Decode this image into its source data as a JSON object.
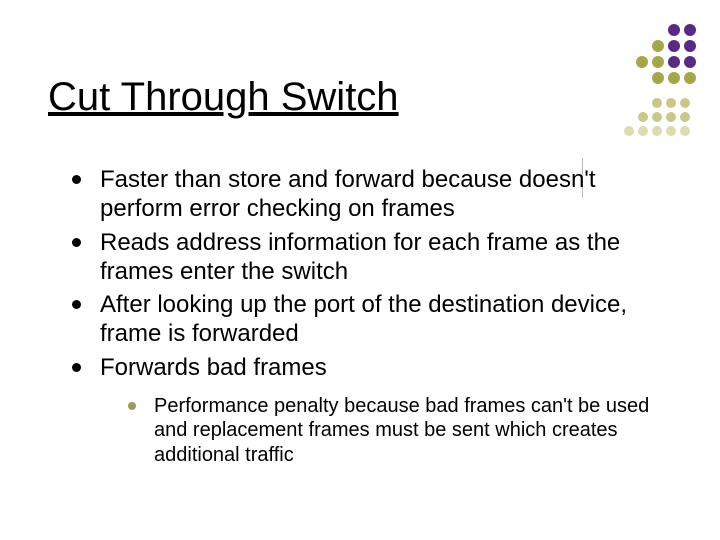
{
  "title": "Cut Through Switch",
  "bullets": {
    "b1": "Faster than store and forward because doesn't perform error checking on frames",
    "b2": "Reads address information for each frame as the frames enter the switch",
    "b3": "After looking up the port of the destination device, frame is forwarded",
    "b4": "Forwards bad frames",
    "sub1": "Performance penalty because bad frames can't be used and replacement frames must be sent which creates additional traffic"
  }
}
